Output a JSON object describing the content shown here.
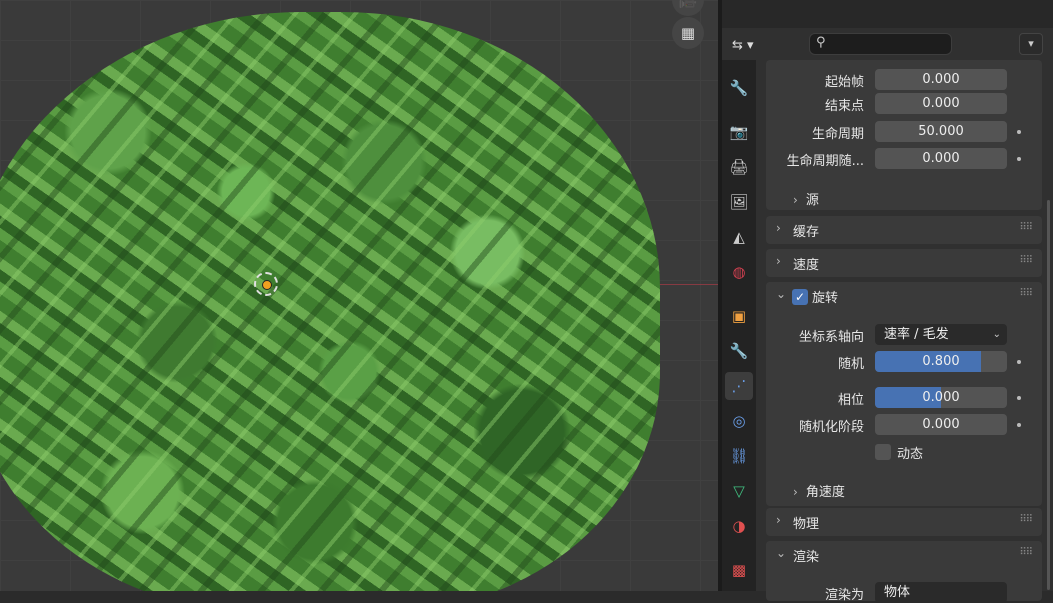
{
  "viewport": {
    "buttons": [
      {
        "name": "camera-view-icon",
        "glyph": "🎥"
      },
      {
        "name": "perspective-grid-icon",
        "glyph": "▦"
      }
    ]
  },
  "header": {
    "editor_type_glyph": "⇆ ▾",
    "search_glyph": "⚲",
    "search_value": "",
    "dropdown_glyph": "▾"
  },
  "tabs": [
    {
      "name": "tool-tab-icon",
      "glyph": "🔧",
      "color": "#cccccc"
    },
    {
      "name": "render-tab-icon",
      "glyph": "📷",
      "color": "#cccccc"
    },
    {
      "name": "output-tab-icon",
      "glyph": "🖨",
      "color": "#cccccc"
    },
    {
      "name": "view-layer-tab-icon",
      "glyph": "🖼",
      "color": "#cccccc"
    },
    {
      "name": "scene-tab-icon",
      "glyph": "◭",
      "color": "#cccccc"
    },
    {
      "name": "world-tab-icon",
      "glyph": "◍",
      "color": "#d04050"
    },
    {
      "name": "object-tab-icon",
      "glyph": "▣",
      "color": "#f0a040"
    },
    {
      "name": "modifier-tab-icon",
      "glyph": "🔧",
      "color": "#6a9ee8"
    },
    {
      "name": "particles-tab-icon",
      "glyph": "⋰",
      "color": "#6a9ee8"
    },
    {
      "name": "physics-tab-icon",
      "glyph": "◎",
      "color": "#6a9ee8"
    },
    {
      "name": "constraints-tab-icon",
      "glyph": "⛓",
      "color": "#6a9ee8"
    },
    {
      "name": "data-tab-icon",
      "glyph": "▽",
      "color": "#40c080"
    },
    {
      "name": "material-tab-icon",
      "glyph": "◑",
      "color": "#e05050"
    },
    {
      "name": "texture-tab-icon",
      "glyph": "▩",
      "color": "#e05050"
    }
  ],
  "emission": {
    "frame_start": {
      "label": "起始帧",
      "value": "0.000"
    },
    "frame_end": {
      "label": "结束点",
      "value": "0.000"
    },
    "lifetime": {
      "label": "生命周期",
      "value": "50.000"
    },
    "lifetime_random": {
      "label": "生命周期随...",
      "value": "0.000"
    },
    "source": {
      "label": "源"
    }
  },
  "panels": {
    "cache": "缓存",
    "velocity": "速度",
    "rotation": "旋转",
    "physics": "物理",
    "render": "渲染"
  },
  "rotation": {
    "orientation_axis": {
      "label": "坐标系轴向",
      "value": "速率 / 毛发"
    },
    "randomize": {
      "label": "随机",
      "value": "0.800",
      "fraction": 0.8
    },
    "phase": {
      "label": "相位",
      "value": "0.000",
      "fraction": 0.5
    },
    "phase_random": {
      "label": "随机化阶段",
      "value": "0.000"
    },
    "dynamic": {
      "label": "动态",
      "checked": false
    },
    "angular_velocity": {
      "label": "角速度"
    }
  },
  "render_partial": {
    "label": "渲染为",
    "value": "物体"
  },
  "glyphs": {
    "chev_right": "›",
    "chev_down": "⌄",
    "check": "✓",
    "grip": "⠿⠿",
    "arrow_down": "⌄"
  }
}
